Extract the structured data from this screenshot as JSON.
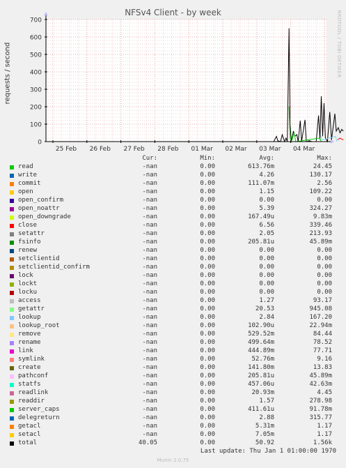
{
  "chart_data": {
    "type": "line",
    "title": "NFSv4 Client - by week",
    "ylabel": "requests / second",
    "xlabel": "",
    "ylim": [
      0,
      700
    ],
    "yticks": [
      0,
      100,
      200,
      300,
      400,
      500,
      600,
      700
    ],
    "categories": [
      "25 Feb",
      "26 Feb",
      "27 Feb",
      "28 Feb",
      "01 Mar",
      "02 Mar",
      "03 Mar",
      "04 Mar"
    ],
    "grid": true,
    "series": [
      {
        "name": "total",
        "color": "#000000",
        "values": [
          [
            6.5,
            0
          ],
          [
            6.58,
            30
          ],
          [
            6.62,
            5
          ],
          [
            6.7,
            0
          ],
          [
            6.75,
            40
          ],
          [
            6.82,
            0
          ],
          [
            6.86,
            20
          ],
          [
            6.9,
            0
          ],
          [
            6.95,
            650
          ],
          [
            6.98,
            100
          ],
          [
            7.02,
            0
          ],
          [
            7.08,
            60
          ],
          [
            7.12,
            30
          ],
          [
            7.18,
            40
          ],
          [
            7.22,
            0
          ],
          [
            7.28,
            120
          ],
          [
            7.32,
            0
          ],
          [
            7.42,
            125
          ],
          [
            7.46,
            0
          ],
          [
            7.55,
            5
          ],
          [
            7.62,
            0
          ],
          [
            7.75,
            0
          ],
          [
            7.82,
            150
          ],
          [
            7.86,
            10
          ],
          [
            7.9,
            260
          ],
          [
            7.94,
            30
          ],
          [
            7.98,
            220
          ],
          [
            8.02,
            20
          ],
          [
            8.08,
            0
          ],
          [
            8.15,
            170
          ],
          [
            8.2,
            10
          ],
          [
            8.3,
            160
          ],
          [
            8.34,
            60
          ],
          [
            8.4,
            80
          ],
          [
            8.45,
            50
          ],
          [
            8.5,
            70
          ],
          [
            8.55,
            60
          ]
        ]
      },
      {
        "name": "read",
        "color": "#00cc00",
        "values": [
          [
            6.95,
            200
          ],
          [
            6.98,
            20
          ],
          [
            7.02,
            0
          ],
          [
            7.1,
            50
          ],
          [
            7.15,
            0
          ],
          [
            7.85,
            20
          ],
          [
            7.9,
            0
          ]
        ]
      },
      {
        "name": "lookup",
        "color": "#8bd1e8",
        "values": [
          [
            7.88,
            40
          ],
          [
            7.92,
            10
          ],
          [
            8.32,
            30
          ],
          [
            8.36,
            0
          ]
        ]
      },
      {
        "name": "close",
        "color": "#ff0000",
        "values": [
          [
            8.38,
            10
          ],
          [
            8.45,
            20
          ],
          [
            8.5,
            15
          ],
          [
            8.55,
            10
          ]
        ]
      }
    ]
  },
  "side_text": "RRDTOOL / TOBI OETIKER",
  "legend_headers": {
    "cur": "Cur:",
    "min": "Min:",
    "avg": "Avg:",
    "max": "Max:"
  },
  "legend": [
    {
      "name": "read",
      "color": "#00cc00",
      "cur": "-nan",
      "min": "0.00",
      "avg": "613.76m",
      "max": "24.45"
    },
    {
      "name": "write",
      "color": "#0066b3",
      "cur": "-nan",
      "min": "0.00",
      "avg": "4.26",
      "max": "130.17"
    },
    {
      "name": "commit",
      "color": "#ff8000",
      "cur": "-nan",
      "min": "0.00",
      "avg": "111.07m",
      "max": "2.56"
    },
    {
      "name": "open",
      "color": "#ffcc00",
      "cur": "-nan",
      "min": "0.00",
      "avg": "1.15",
      "max": "109.22"
    },
    {
      "name": "open_confirm",
      "color": "#330099",
      "cur": "-nan",
      "min": "0.00",
      "avg": "0.00",
      "max": "0.00"
    },
    {
      "name": "open_noattr",
      "color": "#990099",
      "cur": "-nan",
      "min": "0.00",
      "avg": "5.39",
      "max": "324.27"
    },
    {
      "name": "open_downgrade",
      "color": "#ccff00",
      "cur": "-nan",
      "min": "0.00",
      "avg": "167.49u",
      "max": "9.83m"
    },
    {
      "name": "close",
      "color": "#ff0000",
      "cur": "-nan",
      "min": "0.00",
      "avg": "6.56",
      "max": "339.46"
    },
    {
      "name": "setattr",
      "color": "#808080",
      "cur": "-nan",
      "min": "0.00",
      "avg": "2.05",
      "max": "213.93"
    },
    {
      "name": "fsinfo",
      "color": "#008f00",
      "cur": "-nan",
      "min": "0.00",
      "avg": "205.81u",
      "max": "45.89m"
    },
    {
      "name": "renew",
      "color": "#00487d",
      "cur": "-nan",
      "min": "0.00",
      "avg": "0.00",
      "max": "0.00"
    },
    {
      "name": "setclientid",
      "color": "#b35a00",
      "cur": "-nan",
      "min": "0.00",
      "avg": "0.00",
      "max": "0.00"
    },
    {
      "name": "setclientid_confirm",
      "color": "#b38f00",
      "cur": "-nan",
      "min": "0.00",
      "avg": "0.00",
      "max": "0.00"
    },
    {
      "name": "lock",
      "color": "#6b006b",
      "cur": "-nan",
      "min": "0.00",
      "avg": "0.00",
      "max": "0.00"
    },
    {
      "name": "lockt",
      "color": "#8fb300",
      "cur": "-nan",
      "min": "0.00",
      "avg": "0.00",
      "max": "0.00"
    },
    {
      "name": "locku",
      "color": "#b30000",
      "cur": "-nan",
      "min": "0.00",
      "avg": "0.00",
      "max": "0.00"
    },
    {
      "name": "access",
      "color": "#bebebe",
      "cur": "-nan",
      "min": "0.00",
      "avg": "1.27",
      "max": "93.17"
    },
    {
      "name": "getattr",
      "color": "#80ff80",
      "cur": "-nan",
      "min": "0.00",
      "avg": "20.53",
      "max": "945.08"
    },
    {
      "name": "lookup",
      "color": "#80c9ff",
      "cur": "-nan",
      "min": "0.00",
      "avg": "2.84",
      "max": "167.20"
    },
    {
      "name": "lookup_root",
      "color": "#ffc080",
      "cur": "-nan",
      "min": "0.00",
      "avg": "102.90u",
      "max": "22.94m"
    },
    {
      "name": "remove",
      "color": "#ffe680",
      "cur": "-nan",
      "min": "0.00",
      "avg": "529.52m",
      "max": "84.44"
    },
    {
      "name": "rename",
      "color": "#aa80ff",
      "cur": "-nan",
      "min": "0.00",
      "avg": "499.64m",
      "max": "78.52"
    },
    {
      "name": "link",
      "color": "#ee00cc",
      "cur": "-nan",
      "min": "0.00",
      "avg": "444.89m",
      "max": "77.71"
    },
    {
      "name": "symlink",
      "color": "#ff8080",
      "cur": "-nan",
      "min": "0.00",
      "avg": "52.76m",
      "max": "9.16"
    },
    {
      "name": "create",
      "color": "#666600",
      "cur": "-nan",
      "min": "0.00",
      "avg": "141.80m",
      "max": "13.83"
    },
    {
      "name": "pathconf",
      "color": "#ffbfff",
      "cur": "-nan",
      "min": "0.00",
      "avg": "205.81u",
      "max": "45.89m"
    },
    {
      "name": "statfs",
      "color": "#00ffcc",
      "cur": "-nan",
      "min": "0.00",
      "avg": "457.06u",
      "max": "42.63m"
    },
    {
      "name": "readlink",
      "color": "#cc6699",
      "cur": "-nan",
      "min": "0.00",
      "avg": "20.93m",
      "max": "4.45"
    },
    {
      "name": "readdir",
      "color": "#999900",
      "cur": "-nan",
      "min": "0.00",
      "avg": "1.57",
      "max": "278.98"
    },
    {
      "name": "server_caps",
      "color": "#00cc00",
      "cur": "-nan",
      "min": "0.00",
      "avg": "411.61u",
      "max": "91.78m"
    },
    {
      "name": "delegreturn",
      "color": "#0066b3",
      "cur": "-nan",
      "min": "0.00",
      "avg": "2.88",
      "max": "315.77"
    },
    {
      "name": "getacl",
      "color": "#ff8000",
      "cur": "-nan",
      "min": "0.00",
      "avg": "5.31m",
      "max": "1.17"
    },
    {
      "name": "setacl",
      "color": "#ffcc00",
      "cur": "-nan",
      "min": "0.00",
      "avg": "7.05m",
      "max": "1.17"
    },
    {
      "name": "total",
      "color": "#000000",
      "cur": "40.05",
      "min": "0.00",
      "avg": "50.92",
      "max": "1.56k"
    }
  ],
  "last_update": "Last update: Thu Jan  1 01:00:00 1970",
  "footer": "Munin 2.0.75"
}
